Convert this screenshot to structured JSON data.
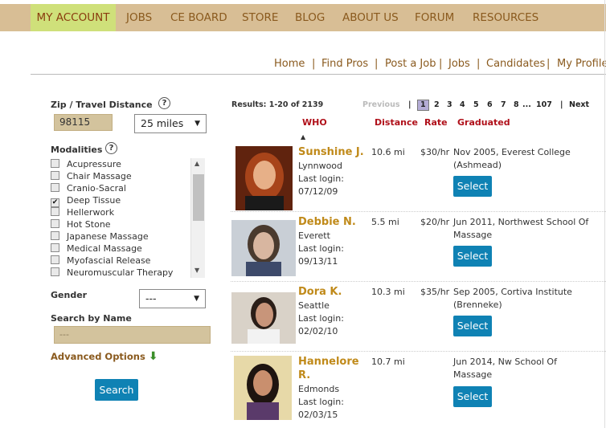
{
  "topnav": {
    "items": [
      {
        "label": "MY ACCOUNT",
        "active": true
      },
      {
        "label": "JOBS"
      },
      {
        "label": "CE BOARD"
      },
      {
        "label": "STORE"
      },
      {
        "label": "BLOG"
      },
      {
        "label": "ABOUT US"
      },
      {
        "label": "FORUM"
      },
      {
        "label": "RESOURCES"
      }
    ]
  },
  "subnav": {
    "links": [
      "Home",
      "Find Pros",
      "Post a Job",
      "Jobs",
      "Candidates",
      "My Profile"
    ],
    "current": "Find Pros",
    "separator": "|"
  },
  "filters": {
    "zip_label": "Zip / Travel Distance",
    "help_glyph": "?",
    "zip_value": "98115",
    "distance_value": "25 miles",
    "modalities_label": "Modalities",
    "modalities": [
      {
        "label": "Acupressure",
        "checked": false
      },
      {
        "label": "Chair Massage",
        "checked": false
      },
      {
        "label": "Cranio-Sacral",
        "checked": false
      },
      {
        "label": "Deep Tissue",
        "checked": true
      },
      {
        "label": "Hellerwork",
        "checked": false
      },
      {
        "label": "Hot Stone",
        "checked": false
      },
      {
        "label": "Japanese Massage",
        "checked": false
      },
      {
        "label": "Medical Massage",
        "checked": false
      },
      {
        "label": "Myofascial Release",
        "checked": false
      },
      {
        "label": "Neuromuscular Therapy",
        "checked": false
      }
    ],
    "gender_label": "Gender",
    "gender_value": "---",
    "search_name_label": "Search by Name",
    "name_placeholder": "---",
    "advanced_label": "Advanced Options",
    "search_button": "Search"
  },
  "results": {
    "summary": "Results: 1-20 of 2139",
    "pager": {
      "previous": "Previous",
      "pages": [
        "1",
        "2",
        "3",
        "4",
        "5",
        "6",
        "7",
        "8",
        "...",
        "107"
      ],
      "current_page": "1",
      "next": "Next",
      "sep": "|"
    },
    "columns": {
      "who": "WHO",
      "distance": "Distance",
      "rate": "Rate",
      "graduated": "Graduated"
    },
    "rows": [
      {
        "name": "Sunshine J.",
        "city": "Lynnwood",
        "login_label": "Last login:",
        "login": "07/12/09",
        "distance": "10.6 mi",
        "rate": "$30/hr",
        "graduated": "Nov 2005, Everest College (Ashmead)",
        "select": "Select"
      },
      {
        "name": "Debbie N.",
        "city": "Everett",
        "login_label": "Last login:",
        "login": "09/13/11",
        "distance": "5.5 mi",
        "rate": "$20/hr",
        "graduated": "Jun 2011, Northwest School Of Massage",
        "select": "Select"
      },
      {
        "name": "Dora K.",
        "city": "Seattle",
        "login_label": "Last login:",
        "login": "02/02/10",
        "distance": "10.3 mi",
        "rate": "$35/hr",
        "graduated": "Sep 2005, Cortiva Institute (Brenneke)",
        "select": "Select"
      },
      {
        "name": "Hannelore R.",
        "city": "Edmonds",
        "login_label": "Last login:",
        "login": "02/03/15",
        "distance": "10.7 mi",
        "rate": "",
        "graduated": "Jun 2014, Nw School Of Massage",
        "select": "Select"
      }
    ]
  },
  "colors": {
    "nav_bg": "#d8be95",
    "nav_active": "#cfe07a",
    "link": "#8a5a1e",
    "header_red": "#b0101a",
    "name_gold": "#c08a1a",
    "button_blue": "#0f82b4",
    "field_tan": "#d3c39d"
  },
  "icons": {
    "help": "help-circle-icon",
    "check": "checkmark-icon",
    "advanced_arrow": "down-arrow-icon",
    "dropdown": "dropdown-arrow-icon",
    "sort": "sort-up-icon"
  }
}
